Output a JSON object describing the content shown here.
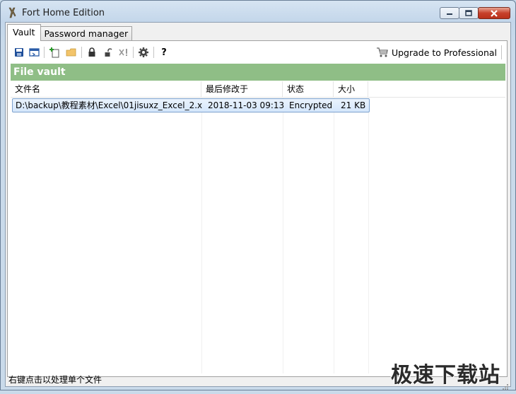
{
  "window": {
    "title": "Fort Home Edition"
  },
  "tabs": [
    {
      "label": "Vault",
      "active": true
    },
    {
      "label": "Password manager",
      "active": false
    }
  ],
  "toolbar": {
    "upgrade_label": "Upgrade to Professional",
    "icons": [
      "save-icon",
      "open-vault-icon",
      "new-file-icon",
      "add-folder-icon",
      "lock-icon",
      "unlock-icon",
      "remove-icon",
      "settings-icon",
      "help-icon"
    ],
    "help_glyph": "?"
  },
  "section": {
    "header": "File vault",
    "color": "#8fbe86"
  },
  "list": {
    "columns": [
      "文件名",
      "最后修改于",
      "状态",
      "大小"
    ],
    "rows": [
      {
        "filename": "D:\\backup\\教程素材\\Excel\\01jisuxz_Excel_2.x...",
        "modified": "2018-11-03 09:13",
        "status": "Encrypted",
        "size": "21 KB"
      }
    ]
  },
  "statusbar": {
    "text": "右键点击以处理单个文件"
  },
  "watermark": {
    "text": "极速下载站"
  }
}
